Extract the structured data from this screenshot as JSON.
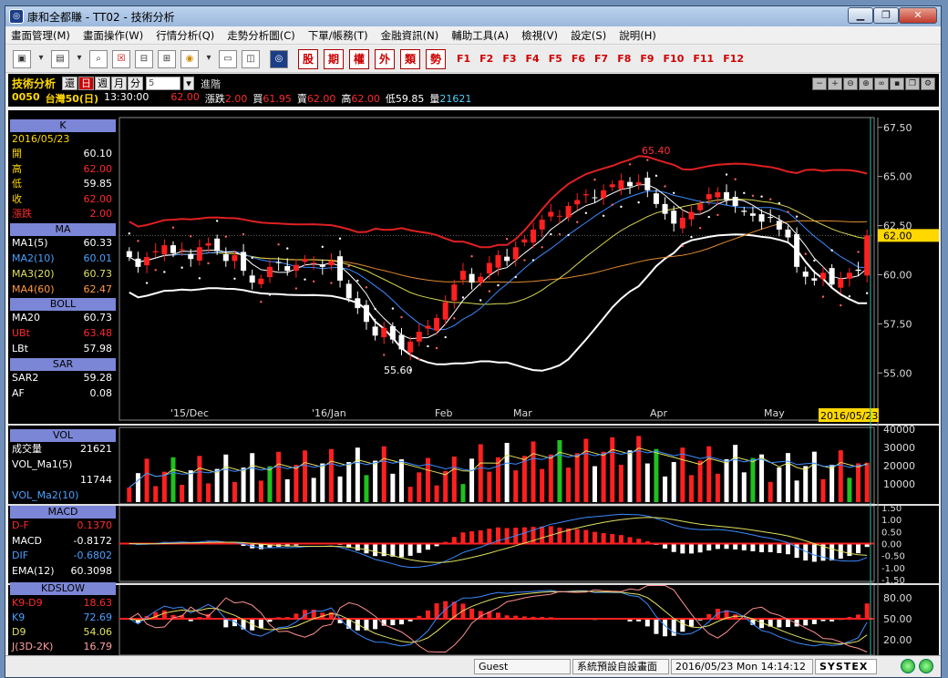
{
  "window": {
    "title": "康和全都賺 - TT02 - 技術分析",
    "minimize_icon": "minimize-icon",
    "maximize_icon": "maximize-icon",
    "close_icon": "close-icon"
  },
  "menu": [
    "畫面管理(M)",
    "畫面操作(W)",
    "行情分析(Q)",
    "走勢分析圖(C)",
    "下單/帳務(T)",
    "金融資訊(N)",
    "輔助工具(A)",
    "檢視(V)",
    "設定(S)",
    "說明(H)"
  ],
  "toolbar": {
    "icons": [
      "layout-icon",
      "monitor-icon",
      "search-icon",
      "close-box-icon",
      "quote-icon",
      "table-icon",
      "coin-icon",
      "card-icon",
      "chart-icon",
      "logo-icon"
    ],
    "red_buttons": [
      "股",
      "期",
      "權",
      "外",
      "類",
      "勢"
    ],
    "function_keys": [
      "F1",
      "F2",
      "F3",
      "F4",
      "F5",
      "F6",
      "F7",
      "F8",
      "F9",
      "F10",
      "F11",
      "F12"
    ]
  },
  "info": {
    "title": "技術分析",
    "period_buttons": [
      "還",
      "日",
      "週",
      "月",
      "分"
    ],
    "selected_period": "日",
    "minute_value": "5",
    "advanced_label": "進階",
    "code": "0050",
    "name": "台灣50(日)",
    "time": "13:30:00",
    "price": "62.00",
    "change_label": "漲跌",
    "change": "2.00",
    "bid_label": "買",
    "bid": "61.95",
    "ask_label": "賣",
    "ask": "62.00",
    "high_label": "高",
    "high": "62.00",
    "low_label": "低",
    "low": "59.85",
    "vol_label": "量",
    "vol": "21621"
  },
  "left_panel": {
    "k_header": "K",
    "date": "2016/05/23",
    "open_label": "開",
    "open": "60.10",
    "high_label": "高",
    "high": "62.00",
    "low_label": "低",
    "low": "59.85",
    "close_label": "收",
    "close": "62.00",
    "chg_label": "漲跌",
    "chg": "2.00",
    "ma_header": "MA",
    "ma": [
      {
        "label": "MA1(5)",
        "value": "60.33",
        "color": "#ffffff"
      },
      {
        "label": "MA2(10)",
        "value": "60.01",
        "color": "#4aa0ff"
      },
      {
        "label": "MA3(20)",
        "value": "60.73",
        "color": "#e0e060"
      },
      {
        "label": "MA4(60)",
        "value": "62.47",
        "color": "#ff9a40"
      }
    ],
    "boll_header": "BOLL",
    "boll": [
      {
        "label": "MA20",
        "value": "60.73",
        "color": "#ffffff"
      },
      {
        "label": "UBt",
        "value": "63.48",
        "color": "#ff2a2a"
      },
      {
        "label": "LBt",
        "value": "57.98",
        "color": "#ffffff"
      }
    ],
    "sar_header": "SAR",
    "sar": [
      {
        "label": "SAR2",
        "value": "59.28",
        "color": "#ffffff"
      },
      {
        "label": "AF",
        "value": "0.08",
        "color": "#ffffff"
      }
    ],
    "vol_header": "VOL",
    "vol": [
      {
        "label": "成交量",
        "value": "21621",
        "color": "#ffffff"
      },
      {
        "label": "VOL_Ma1(5)",
        "value": "",
        "color": "#ffffff"
      },
      {
        "label": "",
        "value": "11744",
        "color": "#ffffff"
      },
      {
        "label": "VOL_Ma2(10)",
        "value": "",
        "color": "#4aa0ff"
      }
    ],
    "macd_header": "MACD",
    "macd": [
      {
        "label": "D-F",
        "value": "0.1370",
        "color": "#ff2a2a"
      },
      {
        "label": "MACD",
        "value": "-0.8172",
        "color": "#ffffff"
      },
      {
        "label": "DIF",
        "value": "-0.6802",
        "color": "#4aa0ff"
      },
      {
        "label": "EMA(12)",
        "value": "60.3098",
        "color": "#ffffff"
      }
    ],
    "kd_header": "KDSLOW",
    "kd": [
      {
        "label": "K9-D9",
        "value": "18.63",
        "color": "#ff2a2a"
      },
      {
        "label": "K9",
        "value": "72.69",
        "color": "#4aa0ff"
      },
      {
        "label": "D9",
        "value": "54.06",
        "color": "#e0e060"
      },
      {
        "label": "J(3D-2K)",
        "value": "16.79",
        "color": "#ffa0a0"
      }
    ]
  },
  "chart_data": {
    "type": "candlestick",
    "price_axis": {
      "ticks": [
        "67.50",
        "65.00",
        "62.50",
        "60.00",
        "57.50",
        "55.00"
      ],
      "range": [
        52.6,
        68.0
      ],
      "current": "62.00"
    },
    "x_labels": [
      "'15/Dec",
      "'16/Jan",
      "Feb",
      "Mar",
      "Apr",
      "May"
    ],
    "cursor_date": "2016/05/23",
    "annotations": {
      "high": "65.40",
      "low": "55.60"
    },
    "closes": [
      60.9,
      60.4,
      60.9,
      61.2,
      61.5,
      61.1,
      61.3,
      60.8,
      61.4,
      61.6,
      61.2,
      60.7,
      61.0,
      60.2,
      59.6,
      59.8,
      60.4,
      60.6,
      60.2,
      60.5,
      60.8,
      60.6,
      60.4,
      60.7,
      59.7,
      58.8,
      58.3,
      57.6,
      56.9,
      57.3,
      56.7,
      56.2,
      56.6,
      57.1,
      57.4,
      57.8,
      58.6,
      59.5,
      60.2,
      59.6,
      59.9,
      60.6,
      61.0,
      60.7,
      61.4,
      61.8,
      62.3,
      62.8,
      63.2,
      63.0,
      63.5,
      63.8,
      64.1,
      63.9,
      64.3,
      64.6,
      64.8,
      64.5,
      64.7,
      64.3,
      63.6,
      63.1,
      62.6,
      62.9,
      63.2,
      63.6,
      64.1,
      64.2,
      63.8,
      63.5,
      63.2,
      63.0,
      62.7,
      62.9,
      62.3,
      61.9,
      60.4,
      59.9,
      59.7,
      60.1,
      59.5,
      59.8,
      60.1,
      60.2,
      62.0
    ],
    "volume_axis": {
      "ticks": [
        "40000",
        "30000",
        "20000",
        "10000"
      ],
      "range": [
        0,
        40000
      ]
    },
    "macd_axis": {
      "ticks": [
        "1.50",
        "1.00",
        "0.50",
        "0.00",
        "-0.50",
        "-1.00",
        "-1.50"
      ],
      "range": [
        -1.5,
        1.5
      ]
    },
    "kd_axis": {
      "ticks": [
        "80.00",
        "50.00",
        "20.00"
      ],
      "range": [
        0,
        100
      ]
    }
  },
  "status": {
    "user": "Guest",
    "layout": "系統預設自設畫面",
    "datetime": "2016/05/23 Mon 14:14:12",
    "brand": "SYSTEX"
  }
}
